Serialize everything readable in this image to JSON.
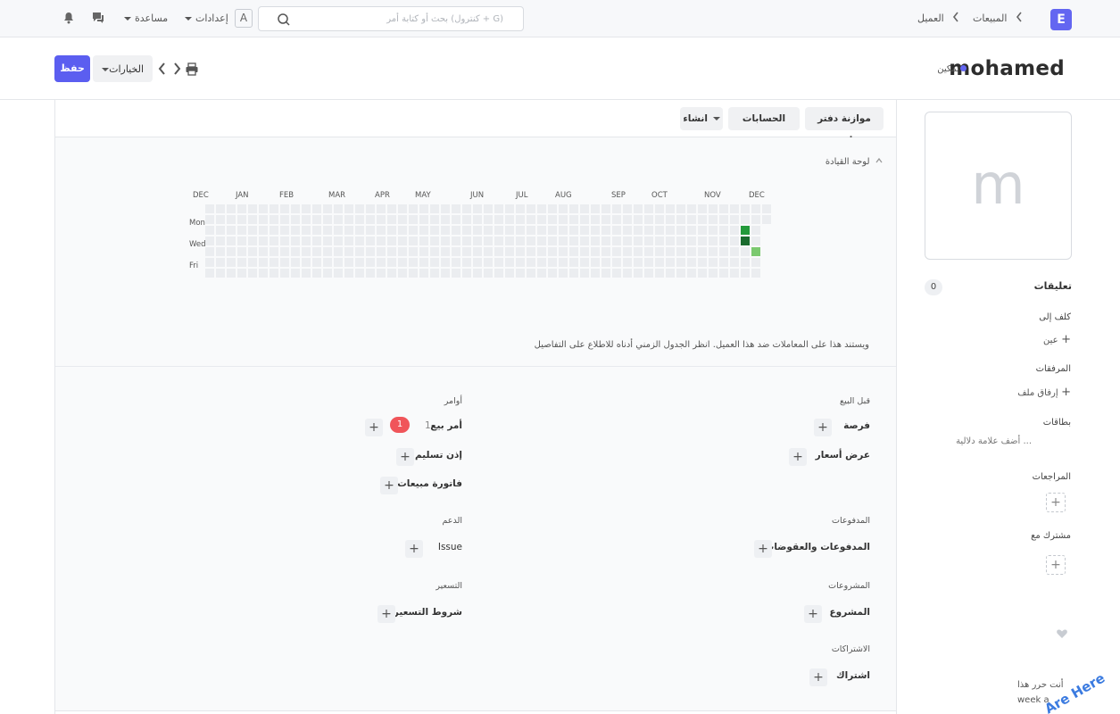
{
  "navbar": {
    "logo_letter": "E",
    "breadcrumbs": [
      "المبيعات",
      "العميل"
    ],
    "search_placeholder": "بحث أو كتابة أمر (كنترول + G)",
    "avatar_letter": "A",
    "settings_label": "إعدادات",
    "help_label": "مساعدة"
  },
  "header": {
    "title": "mohamed",
    "status": "تمكين",
    "status_color": "#6366f1",
    "options_label": "الخيارات",
    "save_label": "حفظ"
  },
  "toolbar": {
    "buttons": [
      "موازنة دفتر الأستاذ",
      "الحسابات المدينة",
      "انشاء"
    ]
  },
  "dashboard": {
    "label": "لوحة القيادة",
    "months": [
      "DEC",
      "JAN",
      "FEB",
      "MAR",
      "APR",
      "MAY",
      "JUN",
      "JUL",
      "AUG",
      "SEP",
      "OCT",
      "NOV",
      "DEC"
    ],
    "days": [
      "Mon",
      "Wed",
      "Fri"
    ],
    "note": "ويستند هذا على المعاملات ضد هذا العميل. انظر الجدول الزمني أدناه للاطلاع على التفاصيل",
    "active_color_dark": "#1a6b2e",
    "active_color_mid": "#239a3b",
    "active_color_light": "#7bc96f"
  },
  "connections": {
    "pre_sales": {
      "title": "قبل البيع",
      "items": [
        "فرصة",
        "عرض أسعار"
      ]
    },
    "orders": {
      "title": "أوامر",
      "items": [
        "أمر بيع",
        "إذن تسليم",
        "فاتورة مبيعات"
      ],
      "sales_order_count": "1",
      "sales_order_badge": "1"
    },
    "payments": {
      "title": "المدفوعات",
      "items": [
        "المدفوعات والعقوضات"
      ]
    },
    "support": {
      "title": "الدعم",
      "items": [
        "Issue"
      ]
    },
    "projects": {
      "title": "المشروعات",
      "items": [
        "المشروع"
      ]
    },
    "pricing": {
      "title": "التسعير",
      "items": [
        "شروط التسعير"
      ]
    },
    "subscriptions": {
      "title": "الاشتراكات",
      "items": [
        "اشتراك"
      ]
    }
  },
  "sidebar": {
    "avatar_letter": "m",
    "comments_label": "تعليقات",
    "comments_count": "0",
    "assigned_label": "كلف إلى",
    "assign_action": "عين",
    "attachments_label": "المرفقات",
    "attach_action": "إرفاق ملف",
    "tags_label": "بطاقات",
    "tags_action": "أضف علامة دلالية ...",
    "reviews_label": "المراجعات",
    "shared_label": "مشترك مع",
    "follow_text": "أنت حرر هذا",
    "week_text": "week a"
  },
  "watermark": "Are Here"
}
